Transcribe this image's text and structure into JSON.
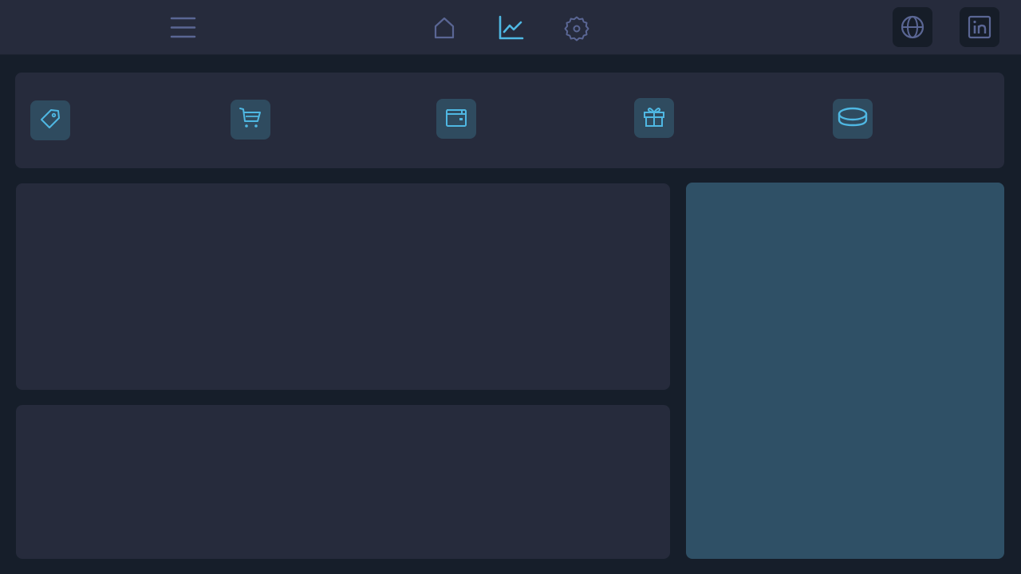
{
  "colors": {
    "page_background": "#161e2a",
    "panel_background": "#262b3c",
    "accent": "#4fb8e3",
    "muted_icon": "#5a6694",
    "tile_background": "#2f4b5f",
    "side_panel_background": "#2f5066",
    "social_button_background": "#161d28"
  },
  "topbar": {
    "menu": {
      "icon": "hamburger-menu-icon"
    },
    "nav": [
      {
        "icon": "home-icon",
        "active": false
      },
      {
        "icon": "chart-line-icon",
        "active": true
      },
      {
        "icon": "gear-icon",
        "active": false
      }
    ],
    "social": [
      {
        "icon": "globe-icon"
      },
      {
        "icon": "linkedin-icon"
      }
    ]
  },
  "quick_actions": [
    {
      "icon": "tag-icon"
    },
    {
      "icon": "shopping-cart-icon"
    },
    {
      "icon": "wallet-icon"
    },
    {
      "icon": "gift-icon"
    },
    {
      "icon": "coin-icon"
    }
  ]
}
